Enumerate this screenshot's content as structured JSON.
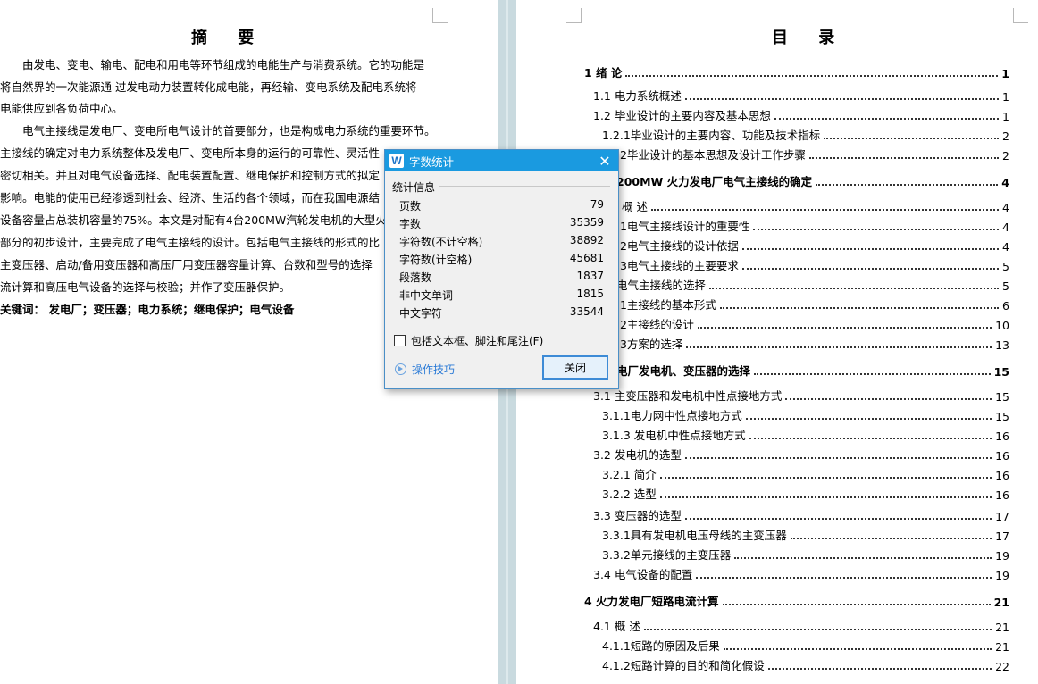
{
  "left_page": {
    "title": "摘 要",
    "paragraphs": [
      "由发电、变电、输电、配电和用电等环节组成的电能生产与消费系统。它的功能是将自然界的一次能源通 过发电动力装置转化成电能，再经输、变电系统及配电系统将电能供应到各负荷中心。",
      "电气主接线是发电厂、变电所电气设计的首要部分，也是构成电力系统的重要环节。主接线的确定对电力系统整体及发电厂、变电所本身的运行的可靠性、灵活性密切相关。并且对电气设备选择、配电装置配置、继电保护和控制方式的拟定影响。电能的使用已经渗透到社会、经济、生活的各个领域，而在我国电源结设备容量占总装机容量的75%。本文是对配有4台200MW汽轮发电机的大型火部分的初步设计，主要完成了电气主接线的设计。包括电气主接线的形式的比主变压器、启动/备用变压器和高压厂用变压器容量计算、台数和型号的选择流计算和高压电气设备的选择与校验；并作了变压器保护。"
    ],
    "lines": [
      "由发电、变电、输电、配电和用电等环节组成的电能生产与消费系统。它的功能是",
      "将自然界的一次能源通  过发电动力装置转化成电能，再经输、变电系统及配电系统将",
      "电能供应到各负荷中心。",
      "电气主接线是发电厂、变电所电气设计的首要部分，也是构成电力系统的重要环节。",
      "主接线的确定对电力系统整体及发电厂、变电所本身的运行的可靠性、灵活性",
      "密切相关。并且对电气设备选择、配电装置配置、继电保护和控制方式的拟定",
      "影响。电能的使用已经渗透到社会、经济、生活的各个领域，而在我国电源结",
      "设备容量占总装机容量的75%。本文是对配有4台200MW汽轮发电机的大型火",
      "部分的初步设计，主要完成了电气主接线的设计。包括电气主接线的形式的比",
      "主变压器、启动/备用变压器和高压厂用变压器容量计算、台数和型号的选择",
      "流计算和高压电气设备的选择与校验；并作了变压器保护。"
    ],
    "keywords": "关键词： 发电厂；变压器；电力系统；继电保护；电气设备"
  },
  "right_page": {
    "title": "目 录",
    "toc": [
      {
        "label": "1  绪 论",
        "page": "1",
        "bold": true
      },
      {
        "label": "1.1  电力系统概述",
        "page": "1",
        "bold": false
      },
      {
        "label": "1.2  毕业设计的主要内容及基本思想",
        "page": "1",
        "bold": false
      },
      {
        "label": "1.2.1毕业设计的主要内容、功能及技术指标",
        "page": "2",
        "bold": false
      },
      {
        "label": ".2毕业设计的基本思想及设计工作步骤",
        "page": "2",
        "bold": false
      },
      {
        "label": "200MW 火力发电厂电气主接线的确定",
        "page": "4",
        "bold": true
      },
      {
        "label": "概 述",
        "page": "4",
        "bold": false
      },
      {
        "label": ".1电气主接线设计的重要性",
        "page": "4",
        "bold": false
      },
      {
        "label": ".2电气主接线的设计依据",
        "page": "4",
        "bold": false
      },
      {
        "label": ".3电气主接线的主要要求",
        "page": "5",
        "bold": false
      },
      {
        "label": "电气主接线的选择",
        "page": "5",
        "bold": false
      },
      {
        "label": ".1主接线的基本形式",
        "page": "6",
        "bold": false
      },
      {
        "label": ".2主接线的设计",
        "page": "10",
        "bold": false
      },
      {
        "label": ".3方案的选择",
        "page": "13",
        "bold": false
      },
      {
        "label": "电厂发电机、变压器的选择",
        "page": "15",
        "bold": true
      },
      {
        "label": "3.1  主变压器和发电机中性点接地方式",
        "page": "15",
        "bold": false
      },
      {
        "label": "3.1.1电力网中性点接地方式",
        "page": "15",
        "bold": false
      },
      {
        "label": "3.1.3  发电机中性点接地方式",
        "page": "16",
        "bold": false
      },
      {
        "label": "3.2    发电机的选型",
        "page": "16",
        "bold": false
      },
      {
        "label": "3.2.1  简介",
        "page": "16",
        "bold": false
      },
      {
        "label": "3.2.2  选型",
        "page": "16",
        "bold": false
      },
      {
        "label": "3.3  变压器的选型",
        "page": "17",
        "bold": false
      },
      {
        "label": "3.3.1具有发电机电压母线的主变压器",
        "page": "17",
        "bold": false
      },
      {
        "label": "3.3.2单元接线的主变压器",
        "page": "19",
        "bold": false
      },
      {
        "label": "3.4  电气设备的配置",
        "page": "19",
        "bold": false
      },
      {
        "label": "4  火力发电厂短路电流计算",
        "page": "21",
        "bold": true
      },
      {
        "label": "4.1  概 述",
        "page": "21",
        "bold": false
      },
      {
        "label": "4.1.1短路的原因及后果",
        "page": "21",
        "bold": false
      },
      {
        "label": "4.1.2短路计算的目的和简化假设",
        "page": "22",
        "bold": false
      }
    ]
  },
  "dialog": {
    "icon_letter": "W",
    "title": "字数统计",
    "group_label": "统计信息",
    "stats": [
      {
        "label": "页数",
        "value": "79"
      },
      {
        "label": "字数",
        "value": "35359"
      },
      {
        "label": "字符数(不计空格)",
        "value": "38892"
      },
      {
        "label": "字符数(计空格)",
        "value": "45681"
      },
      {
        "label": "段落数",
        "value": "1837"
      },
      {
        "label": "非中文单词",
        "value": "1815"
      },
      {
        "label": "中文字符",
        "value": "33544"
      }
    ],
    "checkbox_label": "包括文本框、脚注和尾注(F)",
    "checkbox_checked": false,
    "tips_label": "操作技巧",
    "close_button": "关闭",
    "close_glyph": "✕"
  }
}
